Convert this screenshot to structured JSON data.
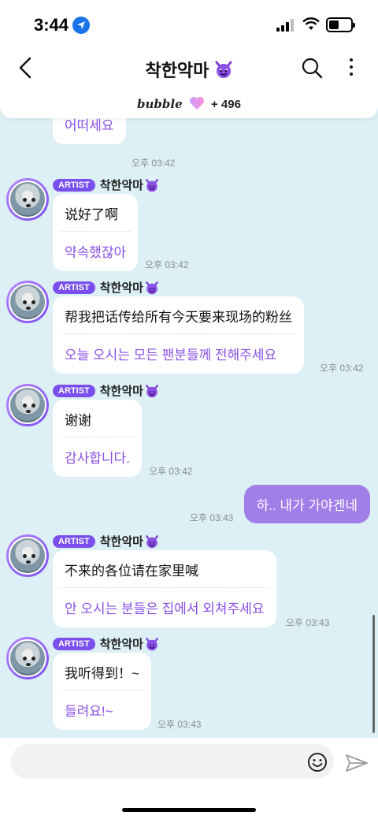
{
  "status_bar": {
    "time": "3:44"
  },
  "header": {
    "title": "착한악마",
    "bubble_brand": "bubble",
    "bubble_count": "+ 496"
  },
  "composer": {
    "placeholder": ""
  },
  "messages": [
    {
      "translation": "어떠세요",
      "time": "오후 03:42"
    },
    {
      "badge": "ARTIST",
      "sender": "착한악마",
      "original": "说好了啊",
      "translation": "약속했잖아",
      "time": "오후 03:42"
    },
    {
      "badge": "ARTIST",
      "sender": "착한악마",
      "original": "帮我把话传给所有今天要来现场的粉丝",
      "translation": "오늘 오시는 모든 팬분들께 전해주세요",
      "time": "오후 03:42"
    },
    {
      "badge": "ARTIST",
      "sender": "착한악마",
      "original": "谢谢",
      "translation": "감사합니다.",
      "time": "오후 03:42"
    },
    {
      "mine": true,
      "text": "하.. 내가 가야겐네",
      "time": "오후 03:43"
    },
    {
      "badge": "ARTIST",
      "sender": "착한악마",
      "original": "不来的各位请在家里喊",
      "translation": "안 오시는 분들은 집에서 외쳐주세요",
      "time": "오후 03:43"
    },
    {
      "badge": "ARTIST",
      "sender": "착한악마",
      "original": "我听得到！~",
      "translation": "들려요!~",
      "time": "오후 03:43"
    }
  ],
  "colors": {
    "accent": "#8a4fe6",
    "badge": "#7b4fee",
    "my_bubble": "#a17ee8",
    "chat_bg": "#dcf0f5"
  },
  "icons": [
    "location-arrow-icon",
    "signal-icon",
    "wifi-icon",
    "battery-icon",
    "back-icon",
    "devil-emoji-icon",
    "search-icon",
    "more-vertical-icon",
    "heart-icon",
    "emoji-icon",
    "send-icon"
  ]
}
